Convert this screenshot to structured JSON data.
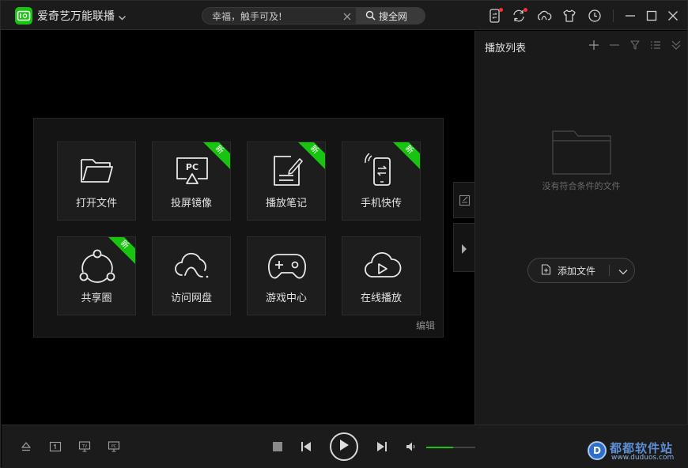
{
  "window": {
    "title": "爱奇艺万能联播"
  },
  "search": {
    "placeholder": "幸福，触手可及!",
    "button_label": "搜全网"
  },
  "colors": {
    "accent": "#19c410",
    "background": "#000000",
    "panel": "#1b1b1b",
    "tile": "#1d1d1d",
    "notification_dot": "#ff3030"
  },
  "titlebar_icons": [
    "phone-transfer-icon",
    "sync-icon",
    "cloud-icon",
    "skin-shirt-icon",
    "history-clock-icon",
    "minimize-icon",
    "maximize-icon",
    "close-icon"
  ],
  "features": {
    "tiles": [
      {
        "label": "打开文件",
        "icon": "folder-icon",
        "badge": ""
      },
      {
        "label": "投屏镜像",
        "icon": "pc-cast-icon",
        "badge": "新"
      },
      {
        "label": "播放笔记",
        "icon": "note-icon",
        "badge": "新"
      },
      {
        "label": "手机快传",
        "icon": "phone-transfer-icon",
        "badge": "新"
      },
      {
        "label": "共享圈",
        "icon": "share-circle-icon",
        "badge": "新"
      },
      {
        "label": "访问网盘",
        "icon": "cloud-drive-icon",
        "badge": ""
      },
      {
        "label": "游戏中心",
        "icon": "gamepad-icon",
        "badge": ""
      },
      {
        "label": "在线播放",
        "icon": "cloud-play-icon",
        "badge": ""
      }
    ],
    "edit_label": "编辑"
  },
  "playlist": {
    "title": "播放列表",
    "tools": [
      "add-icon",
      "remove-icon",
      "filter-icon",
      "list-icon",
      "collapse-icon"
    ],
    "empty_text": "没有符合条件的文件",
    "add_file_label": "添加文件"
  },
  "controls": {
    "left_icons": [
      "eject-icon",
      "subtitle-icon",
      "tv-cast-icon",
      "pc-cast-icon"
    ],
    "volume": 0.55
  },
  "watermark": {
    "badge": "D",
    "name": "都都软件站",
    "url": "www.duduos.com"
  }
}
